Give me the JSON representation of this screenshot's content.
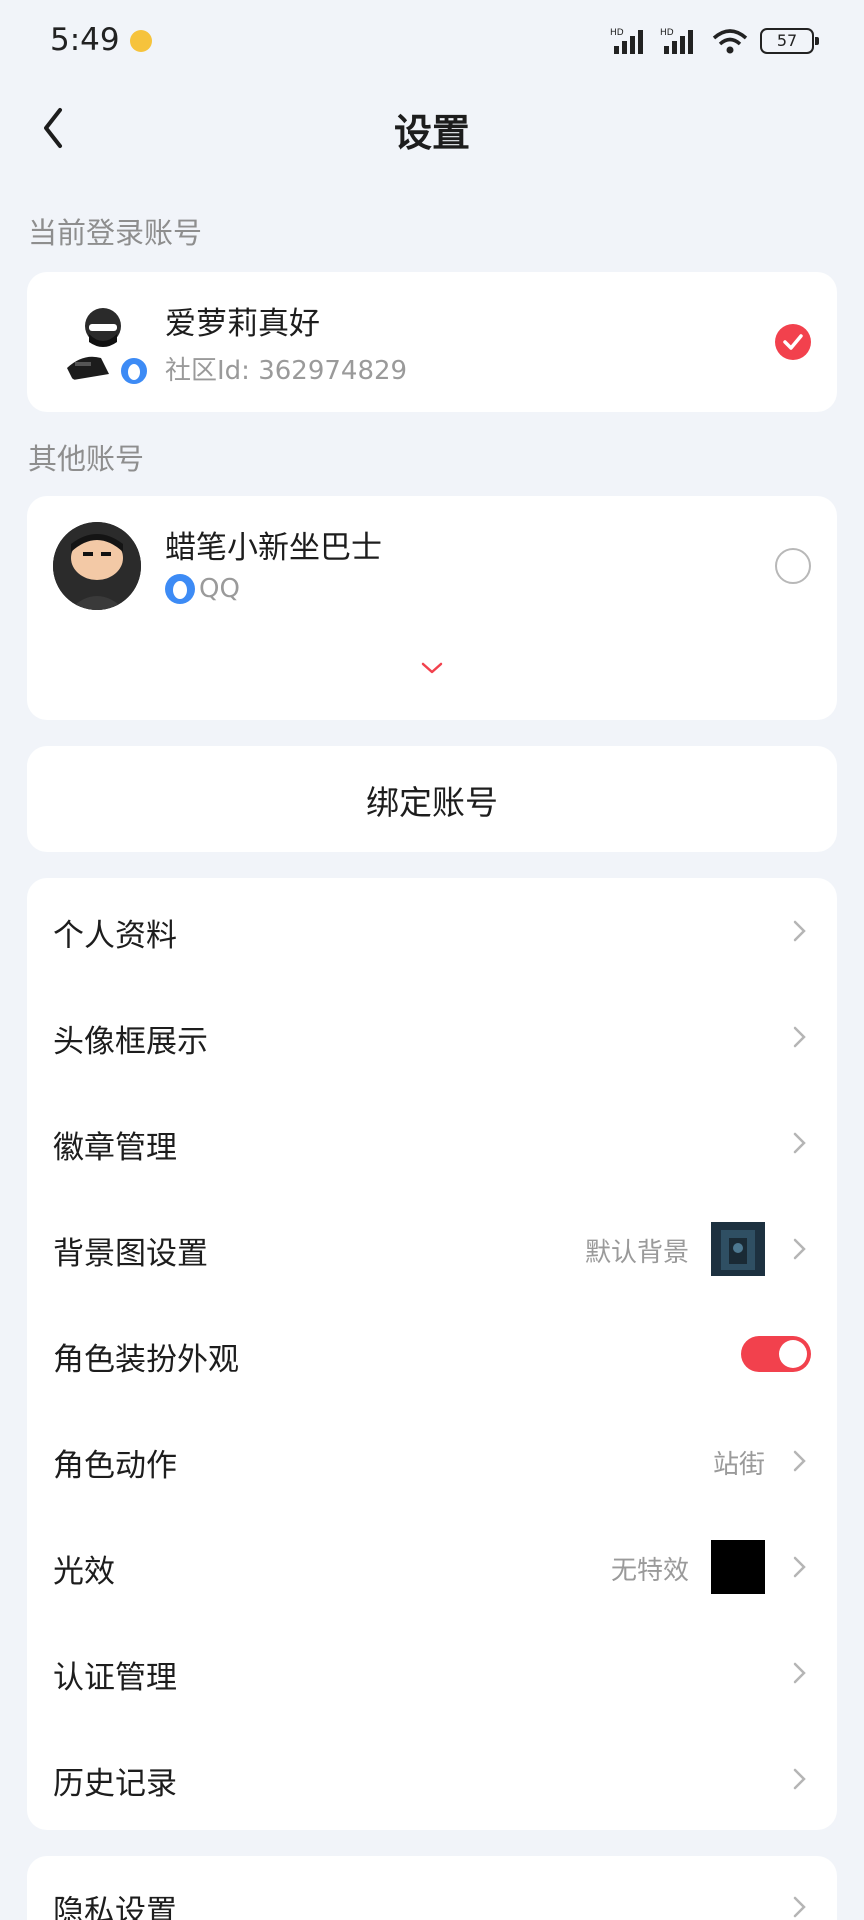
{
  "status_bar": {
    "time": "5:49",
    "battery": "57",
    "signal_label_1": "HD",
    "signal_label_2": "HD"
  },
  "header": {
    "title": "设置"
  },
  "current_account": {
    "section_label": "当前登录账号",
    "name": "爱萝莉真好",
    "community_id": "社区Id: 362974829",
    "selected": true
  },
  "other_accounts": {
    "section_label": "其他账号",
    "items": [
      {
        "name": "蜡笔小新坐巴士",
        "platform": "QQ",
        "selected": false
      }
    ]
  },
  "bind_account": {
    "label": "绑定账号"
  },
  "menu": {
    "items": [
      {
        "label": "个人资料"
      },
      {
        "label": "头像框展示"
      },
      {
        "label": "徽章管理"
      },
      {
        "label": "背景图设置",
        "value": "默认背景"
      },
      {
        "label": "角色装扮外观",
        "toggle_on": true
      },
      {
        "label": "角色动作",
        "value": "站街"
      },
      {
        "label": "光效",
        "value": "无特效"
      },
      {
        "label": "认证管理"
      },
      {
        "label": "历史记录"
      }
    ]
  },
  "privacy": {
    "label": "隐私设置"
  },
  "colors": {
    "accent": "#f2414d",
    "background": "#f1f4f9",
    "card": "#ffffff",
    "secondary_text": "#9a9a9a",
    "qq_blue": "#3d8bf5"
  },
  "icons": {
    "back": "back-arrow-icon",
    "chevron": "chevron-right-icon",
    "expand": "chevron-down-icon",
    "check": "check-circle-icon",
    "qq": "qq-penguin-icon"
  }
}
